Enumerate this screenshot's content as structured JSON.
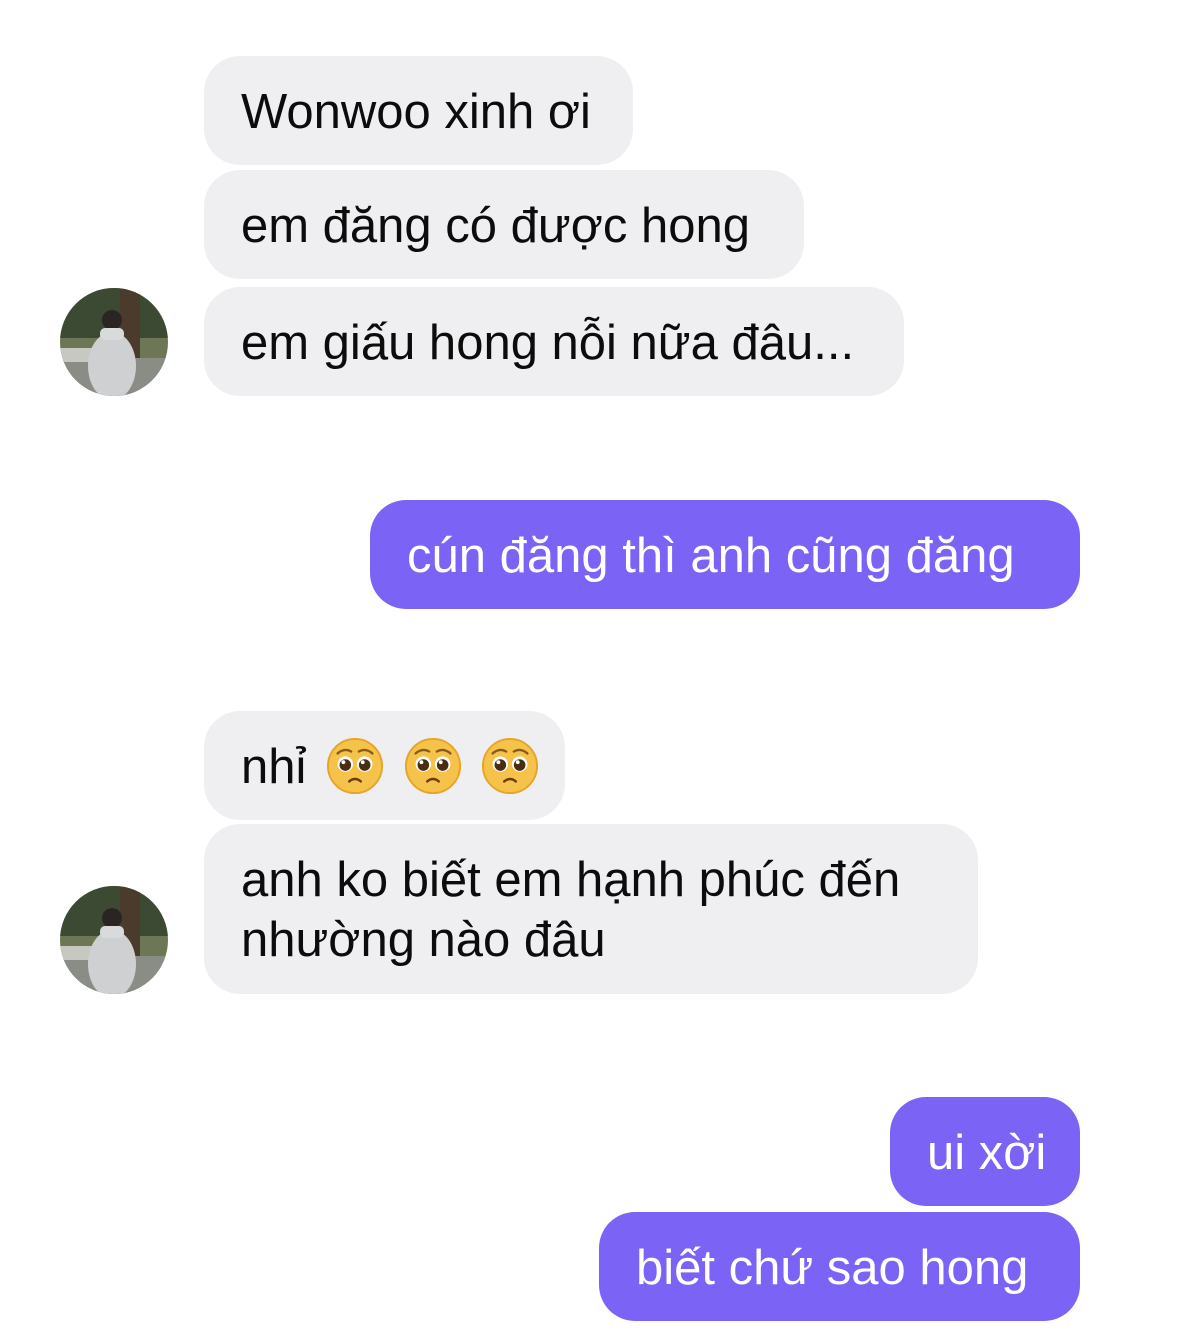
{
  "messages": [
    {
      "sender": "other",
      "text": "Wonwoo xinh ơi"
    },
    {
      "sender": "other",
      "text": "em đăng có được hong"
    },
    {
      "sender": "other",
      "text": "em giấu hong nỗi nữa đâu..."
    },
    {
      "sender": "me",
      "text": "cún đăng thì anh cũng đăng"
    },
    {
      "sender": "other",
      "text": "nhỉ",
      "emoji": "pleading-face-emoji",
      "emoji_count": 3
    },
    {
      "sender": "other",
      "lines": [
        "anh ko biết em hạnh phúc đến",
        "nhường nào đâu"
      ]
    },
    {
      "sender": "me",
      "text": "ui xời"
    },
    {
      "sender": "me",
      "text": "biết chứ sao hong"
    }
  ],
  "colors": {
    "received_bubble": "#efeff2",
    "sent_bubble": "#7a63f5",
    "received_text": "#0c0c0c",
    "sent_text": "#ffffff"
  },
  "icons": {
    "avatar": "contact-avatar-photo",
    "emoji": "pleading-face-emoji"
  }
}
